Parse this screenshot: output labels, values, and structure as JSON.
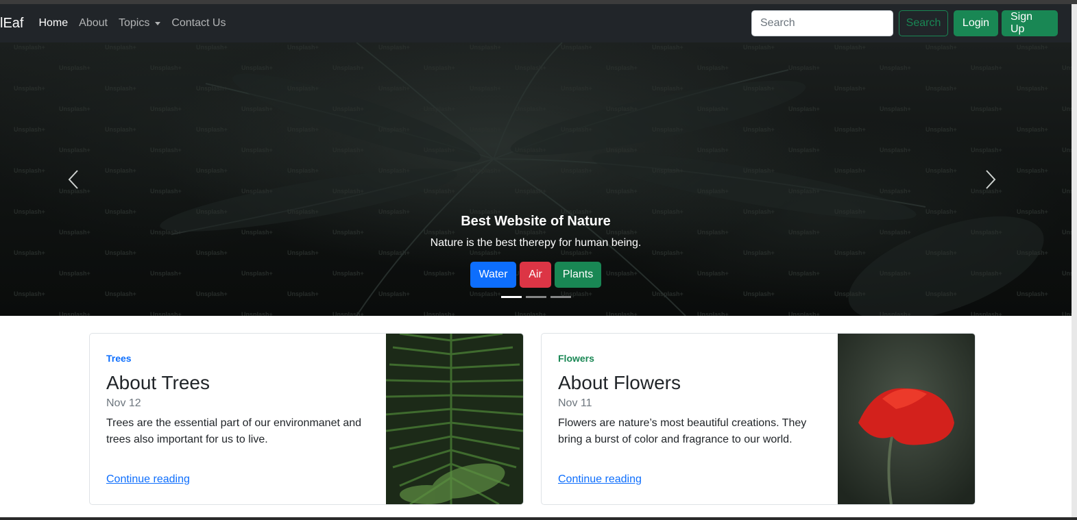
{
  "navbar": {
    "brand": "lEaf",
    "links": [
      "Home",
      "About",
      "Topics",
      "Contact Us"
    ],
    "search_placeholder": "Search",
    "search_button": "Search",
    "login": "Login",
    "signup": "Sign Up"
  },
  "carousel": {
    "title": "Best Website of Nature",
    "subtitle": "Nature is the best therepy for human being.",
    "buttons": [
      "Water",
      "Air",
      "Plants"
    ],
    "watermark": "Unsplash+",
    "active_slide": 1,
    "slide_count": 3
  },
  "cards": [
    {
      "category": "Trees",
      "title": "About Trees",
      "date": "Nov 12",
      "text": "Trees are the essential part of our environmanet and trees also important for us to live.",
      "link": "Continue reading"
    },
    {
      "category": "Flowers",
      "title": "About Flowers",
      "date": "Nov 11",
      "text": "Flowers are nature’s most beautiful creations. They bring a burst of color and fragrance to our world.",
      "link": "Continue reading"
    }
  ],
  "colors": {
    "navbar_bg": "#212529",
    "success": "#198754",
    "primary": "#0d6efd",
    "danger": "#dc3545"
  }
}
